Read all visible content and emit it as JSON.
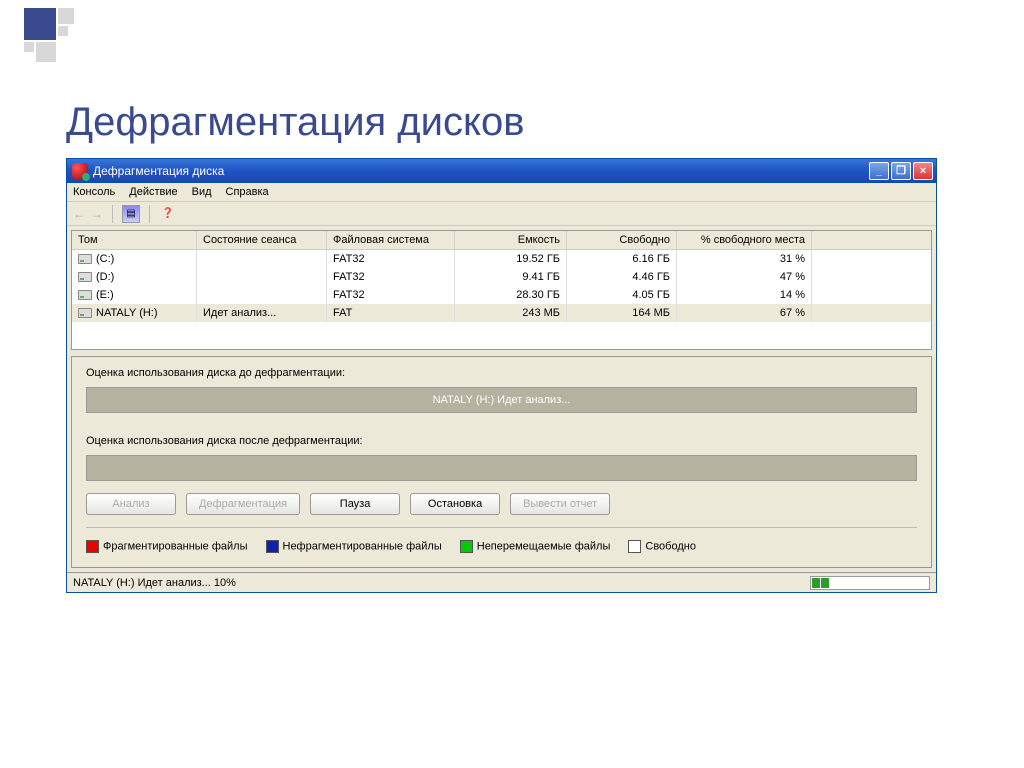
{
  "slide": {
    "title": "Дефрагментация дисков"
  },
  "window": {
    "title": "Дефрагментация диска",
    "menu": {
      "console": "Консоль",
      "action": "Действие",
      "view": "Вид",
      "help": "Справка"
    },
    "columns": {
      "volume": "Том",
      "session": "Состояние сеанса",
      "fs": "Файловая система",
      "capacity": "Емкость",
      "free": "Свободно",
      "pct": "% свободного места"
    },
    "volumes": [
      {
        "name": "(C:)",
        "session": "",
        "fs": "FAT32",
        "capacity": "19.52 ГБ",
        "free": "6.16 ГБ",
        "pct": "31 %"
      },
      {
        "name": "(D:)",
        "session": "",
        "fs": "FAT32",
        "capacity": "9.41 ГБ",
        "free": "4.46 ГБ",
        "pct": "47 %"
      },
      {
        "name": "(E:)",
        "session": "",
        "fs": "FAT32",
        "capacity": "28.30 ГБ",
        "free": "4.05 ГБ",
        "pct": "14 %"
      },
      {
        "name": "NATALY (H:)",
        "session": "Идет анализ...",
        "fs": "FAT",
        "capacity": "243 МБ",
        "free": "164 МБ",
        "pct": "67 %"
      }
    ],
    "before_label": "Оценка использования диска до дефрагментации:",
    "before_text": "NATALY (H:) Идет анализ...",
    "after_label": "Оценка использования диска после дефрагментации:",
    "buttons": {
      "analyze": "Анализ",
      "defrag": "Дефрагментация",
      "pause": "Пауза",
      "stop": "Остановка",
      "report": "Вывести отчет"
    },
    "legend": {
      "frag": "Фрагментированные файлы",
      "unfrag": "Нефрагментированные файлы",
      "unmov": "Неперемещаемые файлы",
      "free": "Свободно"
    },
    "status": "NATALY (H:) Идет анализ... 10%"
  }
}
